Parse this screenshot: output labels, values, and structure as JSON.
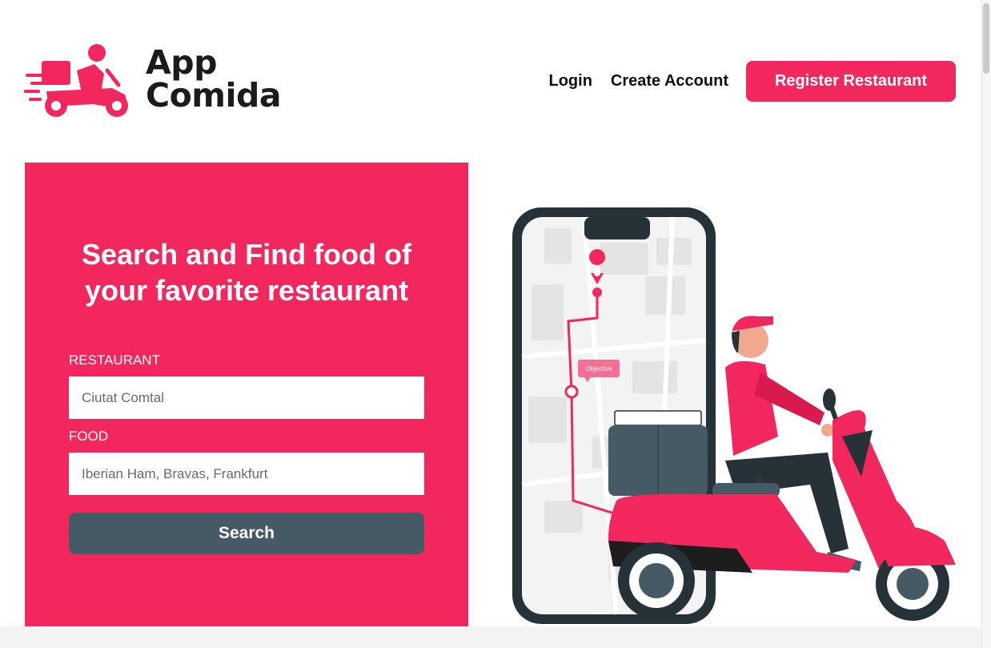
{
  "brand": {
    "line1": "App",
    "line2": "Comida",
    "icon": "delivery-scooter-logo-icon",
    "accent_color": "#f2275d"
  },
  "nav": {
    "login_label": "Login",
    "create_account_label": "Create Account",
    "register_label": "Register Restaurant"
  },
  "search_panel": {
    "title_line1": "Search and Find food of",
    "title_line2": "your favorite restaurant",
    "restaurant_label": "RESTAURANT",
    "restaurant_placeholder": "Ciutat Comtal",
    "food_label": "FOOD",
    "food_placeholder": "Iberian Ham, Bravas, Frankfurt",
    "search_label": "Search",
    "background_color": "#f2275d",
    "button_color": "#455a64"
  },
  "illustration": {
    "icon": "delivery-rider-phone-map-illustration",
    "map_tag": "Objective"
  }
}
